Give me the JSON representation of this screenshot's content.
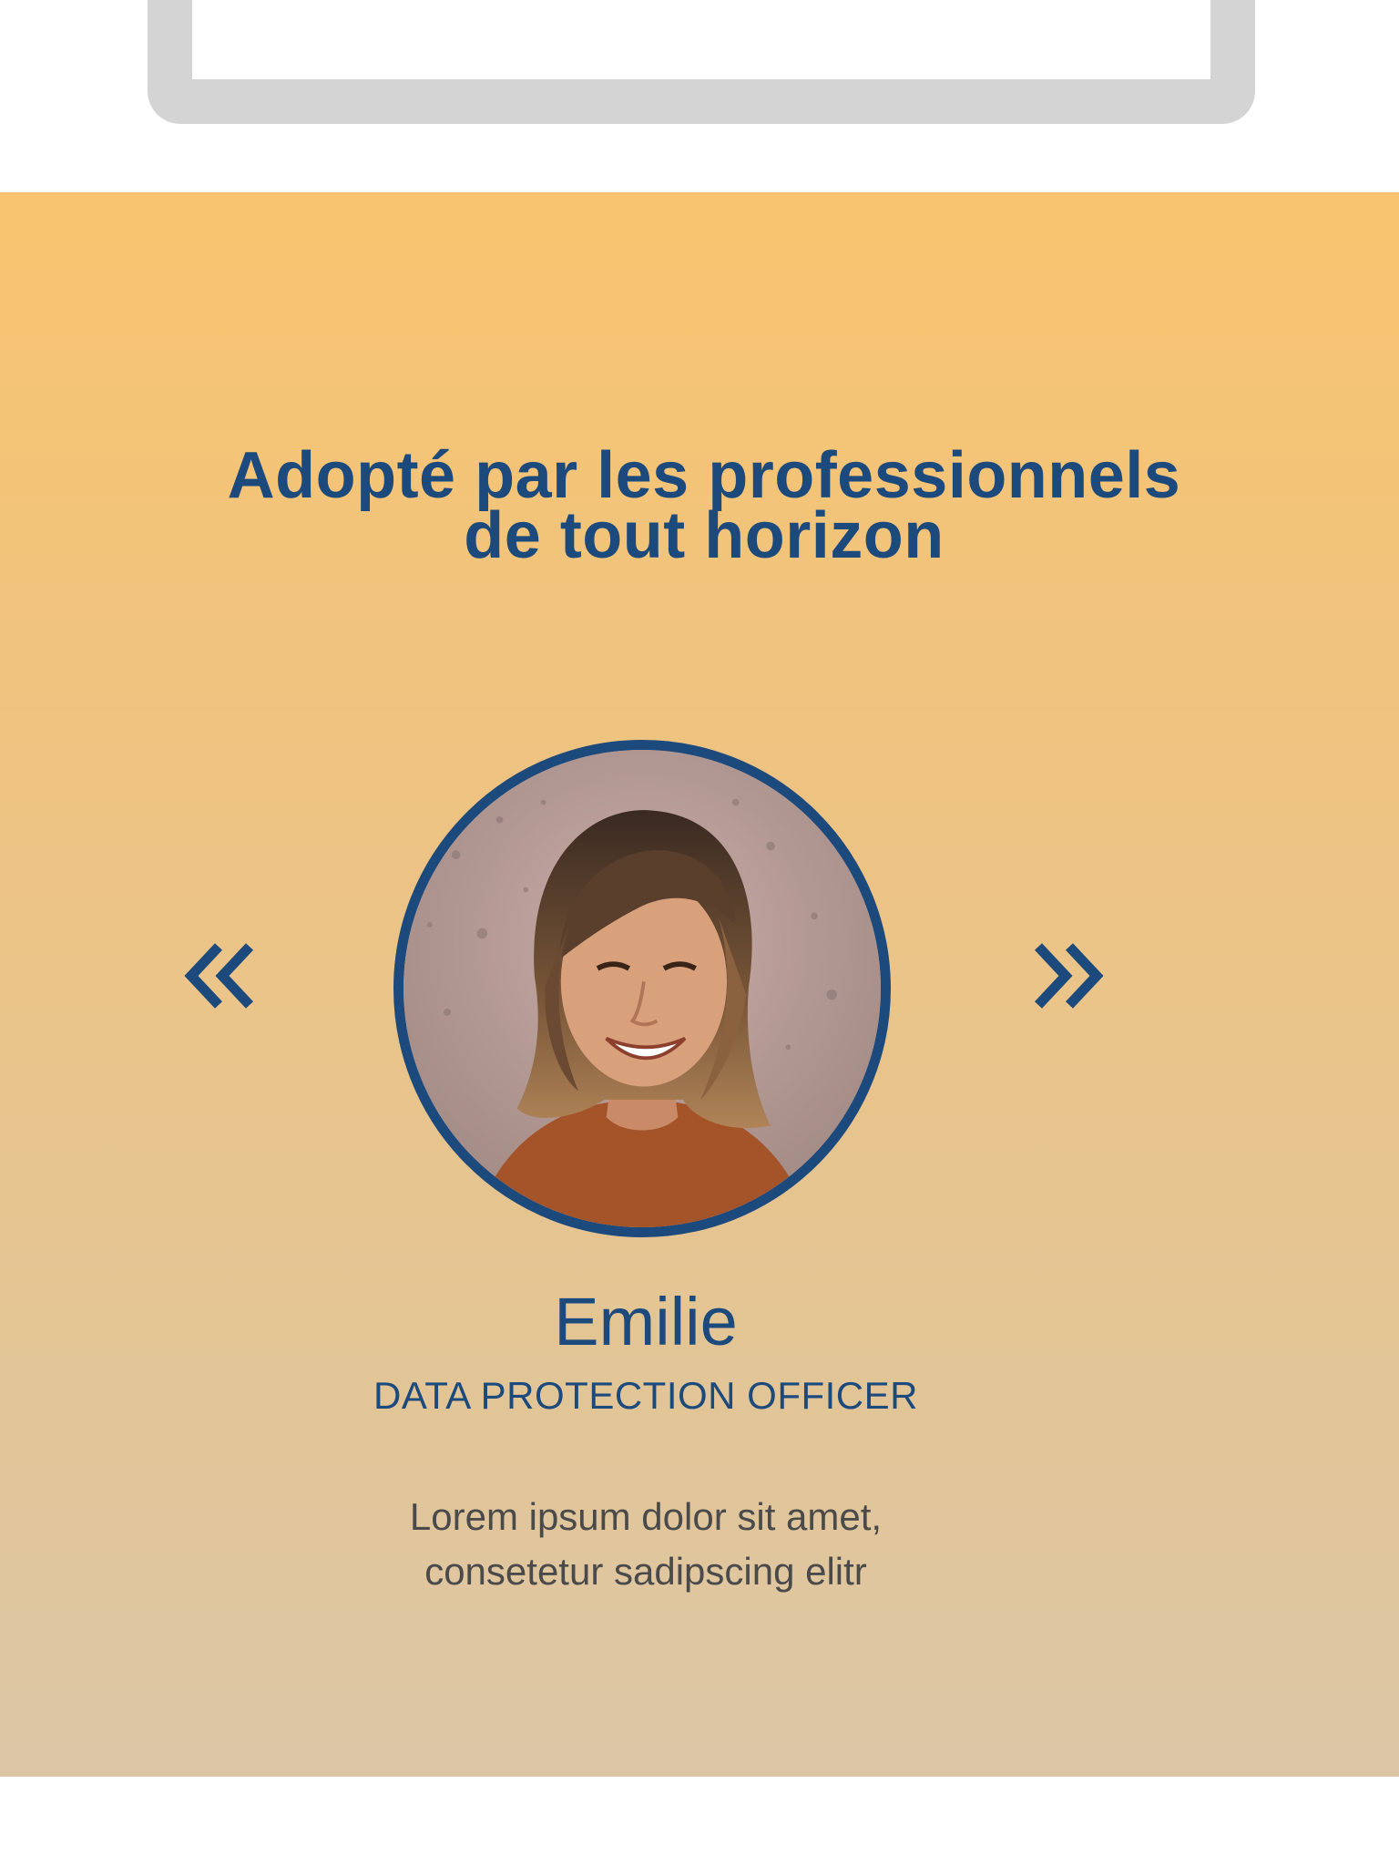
{
  "section": {
    "title_line1": "Adopté par les professionnels",
    "title_line2": "de tout horizon",
    "colors": {
      "gradient_top": "#f8c46f",
      "gradient_bottom": "#dcc6a6",
      "accent": "#1d4a7c",
      "body_text": "#4a4a4a"
    }
  },
  "carousel": {
    "prev_icon": "double-chevron-left-icon",
    "next_icon": "double-chevron-right-icon"
  },
  "testimonial": {
    "name": "Emilie",
    "role": "DATA PROTECTION OFFICER",
    "quote_line1": "Lorem ipsum dolor sit amet,",
    "quote_line2": "consetetur sadipscing elitr"
  }
}
